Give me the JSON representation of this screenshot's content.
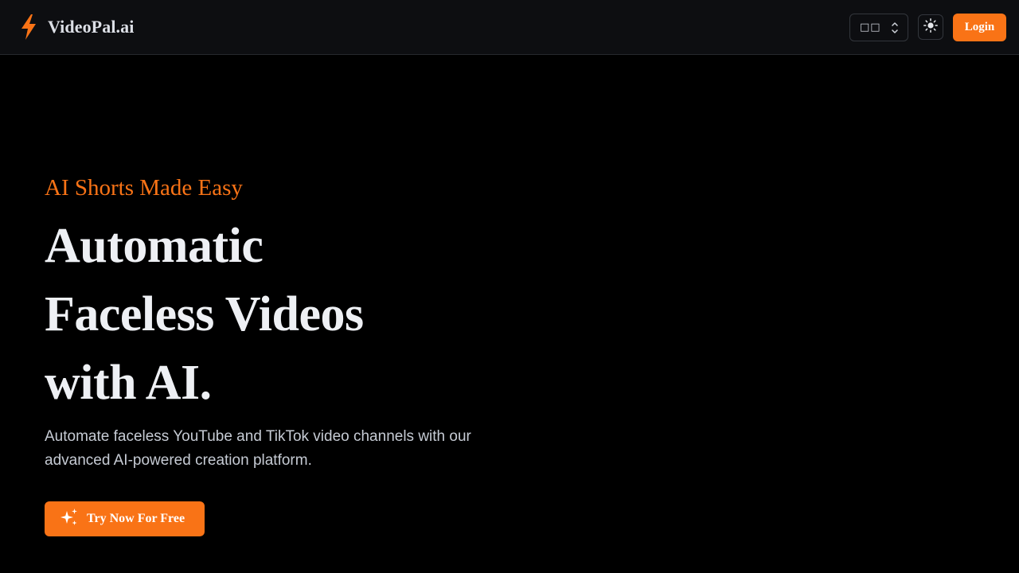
{
  "navbar": {
    "brand_name": "VideoPal.ai",
    "logo_icon": "lightning-bolt-icon",
    "language_select": {
      "value": "□□",
      "icon": "chevron-up-down-icon"
    },
    "theme_toggle_icon": "sun-icon",
    "login_label": "Login"
  },
  "hero": {
    "eyebrow": "AI Shorts Made Easy",
    "headline_lines": [
      "Automatic",
      "Faceless Videos",
      "with AI."
    ],
    "subtitle_lines": [
      "Automate faceless YouTube and TikTok video channels with our",
      "advanced AI-powered creation platform."
    ],
    "cta_label": "Try Now For Free",
    "cta_icon": "sparkles-icon"
  },
  "colors": {
    "accent": "#f97316",
    "background": "#000000",
    "navbar_background": "#0d0e11",
    "headline_text": "#eef0f4",
    "body_text": "#c6cbd4"
  }
}
